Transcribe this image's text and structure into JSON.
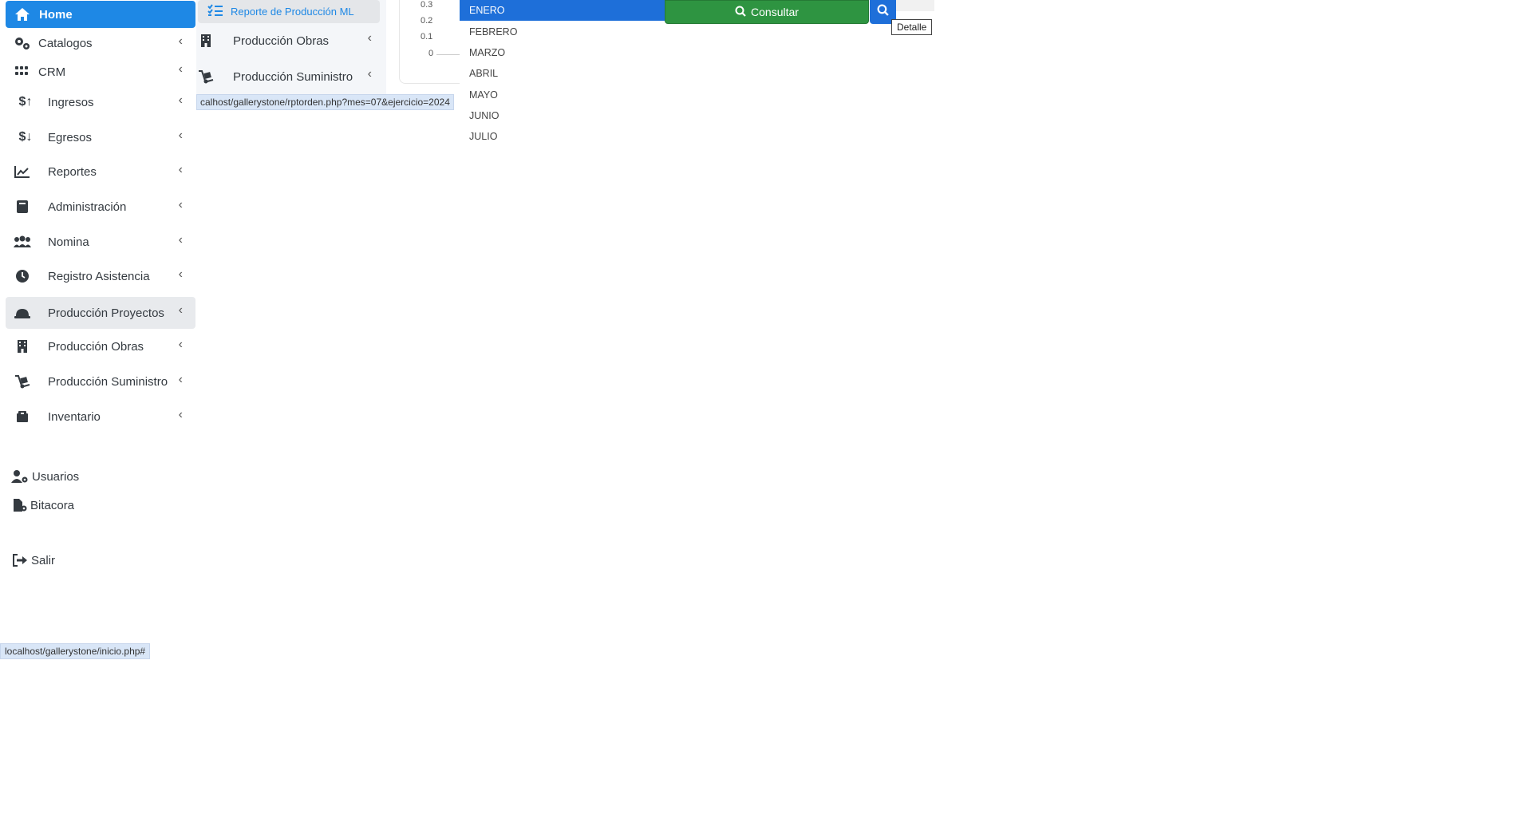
{
  "sidebar": {
    "home": "Home",
    "items": [
      {
        "label": "Catalogos",
        "icon": "gears-icon"
      },
      {
        "label": "CRM",
        "icon": "grid-icon"
      },
      {
        "label": "Ingresos",
        "icon": "dollar-up-icon"
      },
      {
        "label": "Egresos",
        "icon": "dollar-down-icon"
      },
      {
        "label": "Reportes",
        "icon": "chart-line-icon"
      },
      {
        "label": "Administración",
        "icon": "book-icon"
      },
      {
        "label": "Nomina",
        "icon": "people-icon"
      },
      {
        "label": "Registro Asistencia",
        "icon": "clock-icon"
      },
      {
        "label": "Producción Proyectos",
        "icon": "hardhat-icon"
      },
      {
        "label": "Producción Obras",
        "icon": "building-icon"
      },
      {
        "label": "Producción Suministro",
        "icon": "dolly-icon"
      },
      {
        "label": "Inventario",
        "icon": "box-icon"
      }
    ],
    "usuarios": "Usuarios",
    "bitacora": "Bitacora",
    "salir": "Salir",
    "chevron": "‹"
  },
  "status_bar": {
    "main_url": "localhost/gallerystone/inicio.php#",
    "hover_url": "calhost/gallerystone/rptorden.php?mes=07&ejercicio=2024"
  },
  "submenu": {
    "active": "Reporte de Producción ML",
    "items": [
      {
        "label": "Producción Obras"
      },
      {
        "label": "Producción Suministro"
      }
    ]
  },
  "chart_fragment": {
    "ticks": [
      "0.3",
      "0.2",
      "0.1",
      "0"
    ]
  },
  "month_dropdown": {
    "selected": "ENERO",
    "options": [
      "ENERO",
      "FEBRERO",
      "MARZO",
      "ABRIL",
      "MAYO",
      "JUNIO",
      "JULIO"
    ]
  },
  "toolbar": {
    "consultar": "Consultar",
    "tooltip": "Detalle"
  },
  "colors": {
    "primary": "#1e88e5",
    "success": "#2e9441",
    "dropdown_selected": "#1e6fd9"
  }
}
